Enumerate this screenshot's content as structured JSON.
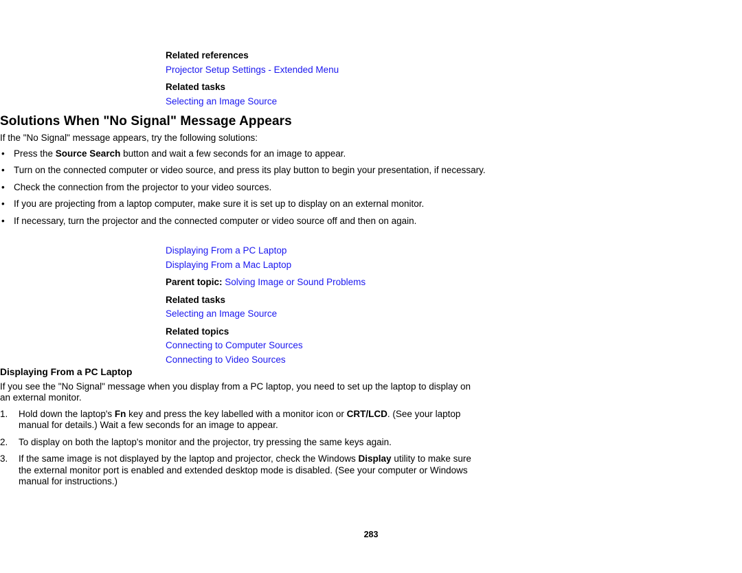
{
  "theme": {
    "link_color": "#1a17ef",
    "text_color": "#000000",
    "background": "#ffffff"
  },
  "top_related": {
    "references_heading": "Related references",
    "references_links": [
      "Projector Setup Settings - Extended Menu"
    ],
    "tasks_heading": "Related tasks",
    "tasks_links": [
      "Selecting an Image Source"
    ]
  },
  "section": {
    "title": "Solutions When \"No Signal\" Message Appears",
    "intro": "If the \"No Signal\" message appears, try the following solutions:",
    "bullets": [
      {
        "pre": "Press the ",
        "bold": "Source Search",
        "post": " button and wait a few seconds for an image to appear."
      },
      {
        "pre": "Turn on the connected computer or video source, and press its play button to begin your presentation, if necessary.",
        "bold": "",
        "post": ""
      },
      {
        "pre": "Check the connection from the projector to your video sources.",
        "bold": "",
        "post": ""
      },
      {
        "pre": "If you are projecting from a laptop computer, make sure it is set up to display on an external monitor.",
        "bold": "",
        "post": ""
      },
      {
        "pre": "If necessary, turn the projector and the connected computer or video source off and then on again.",
        "bold": "",
        "post": ""
      }
    ],
    "bullet_mark": "•"
  },
  "bottom_related": {
    "child_links": [
      "Displaying From a PC Laptop",
      "Displaying From a Mac Laptop"
    ],
    "parent_topic_label": "Parent topic:",
    "parent_topic_link": "Solving Image or Sound Problems",
    "tasks_heading": "Related tasks",
    "tasks_links": [
      "Selecting an Image Source"
    ],
    "topics_heading": "Related topics",
    "topics_links": [
      "Connecting to Computer Sources",
      "Connecting to Video Sources"
    ]
  },
  "pc_laptop": {
    "heading": "Displaying From a PC Laptop",
    "intro": "If you see the \"No Signal\" message when you display from a PC laptop, you need to set up the laptop to display on an external monitor.",
    "steps": [
      {
        "num": "1.",
        "pre": "Hold down the laptop's ",
        "bold1": "Fn",
        "mid": " key and press the key labelled with a monitor icon or ",
        "bold2": "CRT/LCD",
        "post": ". (See your laptop manual for details.) Wait a few seconds for an image to appear."
      },
      {
        "num": "2.",
        "pre": "To display on both the laptop's monitor and the projector, try pressing the same keys again.",
        "bold1": "",
        "mid": "",
        "bold2": "",
        "post": ""
      },
      {
        "num": "3.",
        "pre": "If the same image is not displayed by the laptop and projector, check the Windows ",
        "bold1": "Display",
        "mid": "",
        "bold2": "",
        "post": " utility to make sure the external monitor port is enabled and extended desktop mode is disabled. (See your computer or Windows manual for instructions.)"
      }
    ]
  },
  "footer": {
    "page_number": "283"
  }
}
